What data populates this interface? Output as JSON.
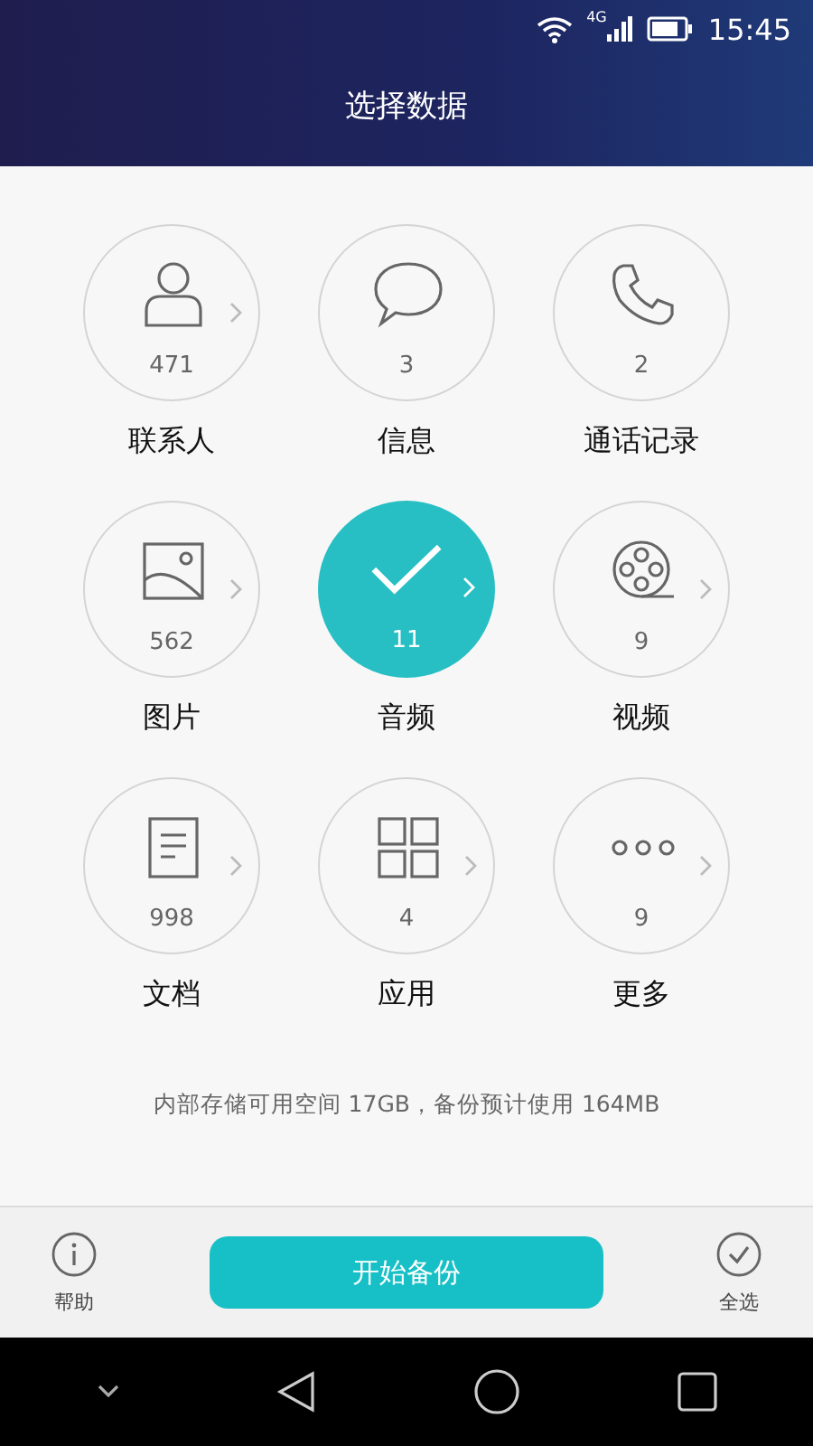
{
  "status_bar": {
    "network": "4G",
    "time": "15:45"
  },
  "header": {
    "title": "选择数据"
  },
  "categories": [
    {
      "kind": "contacts",
      "count": "471",
      "label": "联系人",
      "selected": false,
      "expandable": true
    },
    {
      "kind": "messages",
      "count": "3",
      "label": "信息",
      "selected": false,
      "expandable": false
    },
    {
      "kind": "calls",
      "count": "2",
      "label": "通话记录",
      "selected": false,
      "expandable": false
    },
    {
      "kind": "pictures",
      "count": "562",
      "label": "图片",
      "selected": false,
      "expandable": true
    },
    {
      "kind": "audio",
      "count": "11",
      "label": "音频",
      "selected": true,
      "expandable": true
    },
    {
      "kind": "video",
      "count": "9",
      "label": "视频",
      "selected": false,
      "expandable": true
    },
    {
      "kind": "documents",
      "count": "998",
      "label": "文档",
      "selected": false,
      "expandable": true
    },
    {
      "kind": "apps",
      "count": "4",
      "label": "应用",
      "selected": false,
      "expandable": true
    },
    {
      "kind": "more",
      "count": "9",
      "label": "更多",
      "selected": false,
      "expandable": true
    }
  ],
  "storage_info": "内部存储可用空间 17GB，备份预计使用 164MB",
  "bottom_bar": {
    "help": "帮助",
    "start": "开始备份",
    "select_all": "全选"
  }
}
